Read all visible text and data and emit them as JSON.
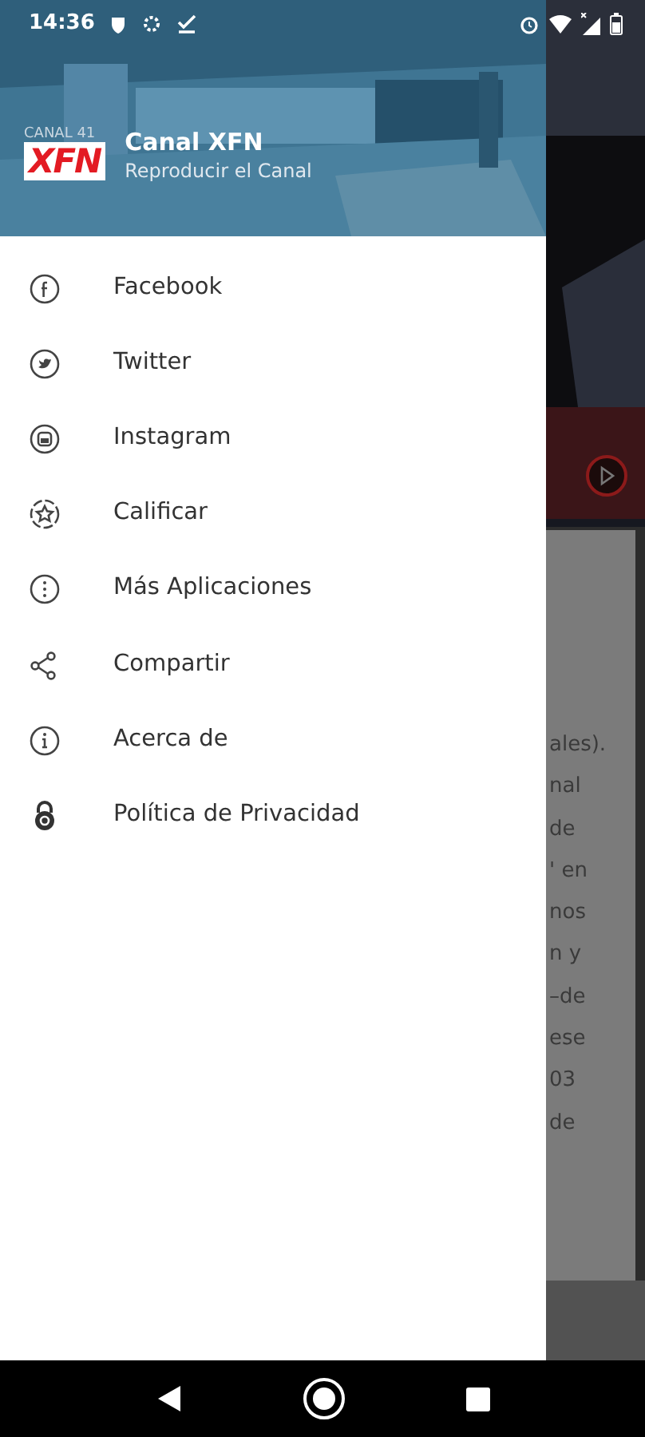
{
  "status_bar": {
    "time": "14:36"
  },
  "drawer": {
    "header": {
      "logo_caption": "CANAL 41",
      "logo": "XFN",
      "title": "Canal XFN",
      "subtitle": "Reproducir el Canal"
    },
    "items": [
      {
        "label": "Facebook"
      },
      {
        "label": "Twitter"
      },
      {
        "label": "Instagram"
      },
      {
        "label": "Calificar"
      },
      {
        "label": "Más Aplicaciones"
      },
      {
        "label": "Compartir"
      },
      {
        "label": "Acerca de"
      },
      {
        "label": "Política de Privacidad"
      }
    ]
  },
  "background": {
    "text_fragments": [
      "ales).",
      "nal",
      "de",
      "' en",
      "nos",
      "n y",
      "–de",
      "ese",
      "03",
      "de"
    ]
  }
}
